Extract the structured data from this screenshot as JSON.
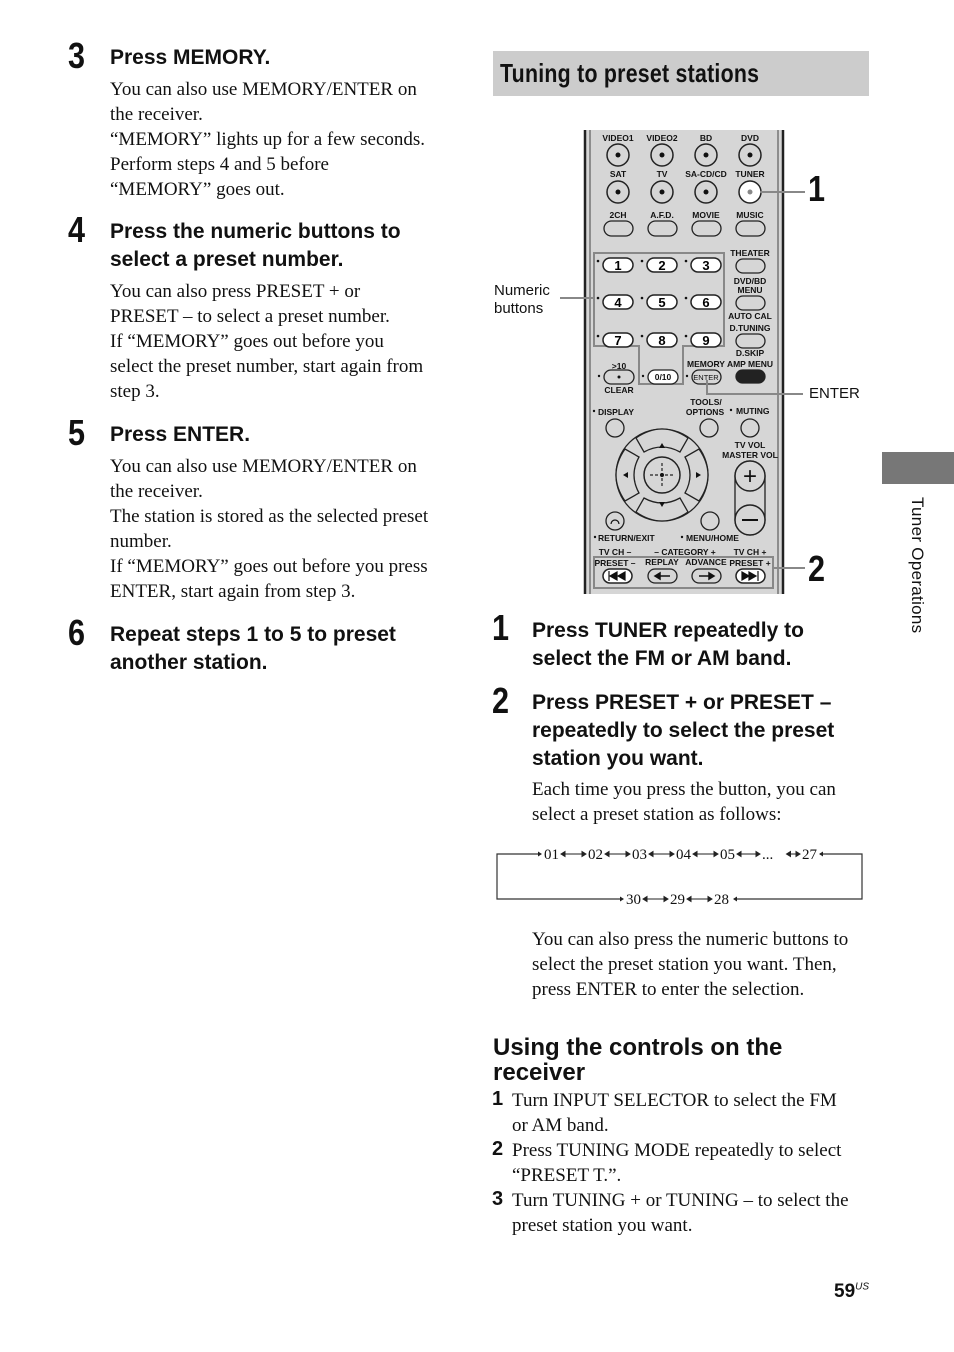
{
  "left_steps": [
    {
      "number": "3",
      "heading": "Press MEMORY.",
      "lines": [
        "You can also use MEMORY/ENTER on",
        "the receiver.",
        "“MEMORY” lights up for a few seconds.",
        "Perform steps 4 and 5 before",
        "“MEMORY” goes out."
      ]
    },
    {
      "number": "4",
      "heading_lines": [
        "Press the numeric buttons to",
        "select a preset number."
      ],
      "lines": [
        "You can also press PRESET + or",
        "PRESET – to select a preset number.",
        "If “MEMORY” goes out before you",
        "select the preset number, start again from",
        "step 3."
      ]
    },
    {
      "number": "5",
      "heading": "Press ENTER.",
      "lines": [
        "You can also use MEMORY/ENTER on",
        "the receiver.",
        "The station is stored as the selected preset",
        "number.",
        "If “MEMORY” goes out before you press",
        "ENTER, start again from step 3."
      ]
    },
    {
      "number": "6",
      "heading_lines": [
        "Repeat steps 1 to 5 to preset",
        "another station."
      ]
    }
  ],
  "section": {
    "title": "Tuning to preset stations"
  },
  "figure": {
    "callouts": {
      "numeric_buttons": [
        "Numeric",
        "buttons"
      ],
      "enter": "ENTER",
      "step1": "1",
      "step2": "2"
    },
    "remote": {
      "row1": [
        "VIDEO1",
        "VIDEO2",
        "BD",
        "DVD"
      ],
      "row2": [
        "SAT",
        "TV",
        "SA-CD/CD",
        "TUNER"
      ],
      "row3": [
        "2CH",
        "A.F.D.",
        "MOVIE",
        "MUSIC"
      ],
      "numeric": [
        "1",
        "2",
        "3",
        "4",
        "5",
        "6",
        "7",
        "8",
        "9"
      ],
      "right_labels": [
        "THEATER",
        "DVD/BD",
        "MENU",
        "AUTO CAL",
        "D.TUNING",
        "D.SKIP",
        "AMP MENU"
      ],
      "gt10": ">10",
      "clear": "CLEAR",
      "zero": "0/10",
      "memory": "MEMORY",
      "enter_btn": "ENTER",
      "display": "DISPLAY",
      "tools": [
        "TOOLS/",
        "OPTIONS"
      ],
      "muting": "MUTING",
      "tv_vol": "TV VOL",
      "master_vol": "MASTER VOL",
      "return_exit": "RETURN/EXIT",
      "menu_home": "MENU/HOME",
      "tv_ch_minus": "TV CH –",
      "category": "– CATEGORY +",
      "tv_ch_plus": "TV CH +",
      "preset_minus": "PRESET –",
      "replay": "REPLAY",
      "advance": "ADVANCE",
      "preset_plus": "PRESET +"
    }
  },
  "right_steps": [
    {
      "number": "1",
      "heading_lines": [
        "Press TUNER repeatedly to",
        "select the FM or AM band."
      ]
    },
    {
      "number": "2",
      "heading_lines": [
        "Press PRESET + or PRESET –",
        "repeatedly to select the preset",
        "station you want."
      ],
      "lines": [
        "Each time you press the button, you can",
        "select a preset station as follows:"
      ],
      "after_lines": [
        "You can also press the numeric buttons to",
        "select the preset station you want. Then,",
        "press ENTER to enter the selection."
      ]
    }
  ],
  "sequence": {
    "top": [
      "01",
      "02",
      "03",
      "04",
      "05",
      "...",
      "27"
    ],
    "bottom": [
      "30",
      "29",
      "28"
    ]
  },
  "receiver_section": {
    "heading_lines": [
      "Using the controls on the",
      "receiver"
    ],
    "steps": [
      {
        "number": "1",
        "lines": [
          "Turn INPUT SELECTOR to select the FM",
          "or AM band."
        ]
      },
      {
        "number": "2",
        "lines": [
          "Press TUNING MODE repeatedly to select",
          "“PRESET T.”."
        ]
      },
      {
        "number": "3",
        "lines": [
          "Turn TUNING + or TUNING – to select the",
          "preset station you want."
        ]
      }
    ]
  },
  "side_tab": {
    "label": "Tuner Operations"
  },
  "page": {
    "number": "59",
    "suffix": "US"
  }
}
